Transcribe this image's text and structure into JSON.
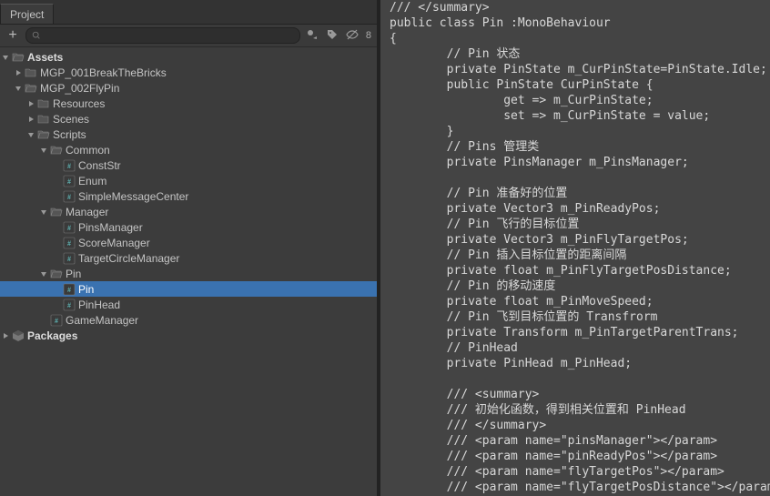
{
  "panel": {
    "tab": "Project",
    "hidden_count": "8"
  },
  "tree": {
    "root0": "Assets",
    "n1": "MGP_001BreakTheBricks",
    "n2": "MGP_002FlyPin",
    "n3": "Resources",
    "n4": "Scenes",
    "n5": "Scripts",
    "n6": "Common",
    "n7": "ConstStr",
    "n8": "Enum",
    "n9": "SimpleMessageCenter",
    "n10": "Manager",
    "n11": "PinsManager",
    "n12": "ScoreManager",
    "n13": "TargetCircleManager",
    "n14": "Pin",
    "n15": "Pin",
    "n16": "PinHead",
    "n17": "GameManager",
    "root1": "Packages"
  },
  "code": {
    "l0": "/// </summary>",
    "l1": "public class Pin :MonoBehaviour",
    "l2": "{",
    "l3": "        // Pin 状态",
    "l4": "        private PinState m_CurPinState=PinState.Idle;",
    "l5": "        public PinState CurPinState {",
    "l6": "                get => m_CurPinState;",
    "l7": "                set => m_CurPinState = value;",
    "l8": "        }",
    "l9": "        // Pins 管理类",
    "l10": "        private PinsManager m_PinsManager;",
    "l11": "",
    "l12": "        // Pin 准备好的位置",
    "l13": "        private Vector3 m_PinReadyPos;",
    "l14": "        // Pin 飞行的目标位置",
    "l15": "        private Vector3 m_PinFlyTargetPos;",
    "l16": "        // Pin 插入目标位置的距离间隔",
    "l17": "        private float m_PinFlyTargetPosDistance;",
    "l18": "        // Pin 的移动速度",
    "l19": "        private float m_PinMoveSpeed;",
    "l20": "        // Pin 飞到目标位置的 Transfrorm",
    "l21": "        private Transform m_PinTargetParentTrans;",
    "l22": "        // PinHead",
    "l23": "        private PinHead m_PinHead;",
    "l24": "",
    "l25": "        /// <summary>",
    "l26": "        /// 初始化函数，得到相关位置和 PinHead",
    "l27": "        /// </summary>",
    "l28": "        /// <param name=\"pinsManager\"></param>",
    "l29": "        /// <param name=\"pinReadyPos\"></param>",
    "l30": "        /// <param name=\"flyTargetPos\"></param>",
    "l31": "        /// <param name=\"flyTargetPosDistance\"></param>"
  }
}
